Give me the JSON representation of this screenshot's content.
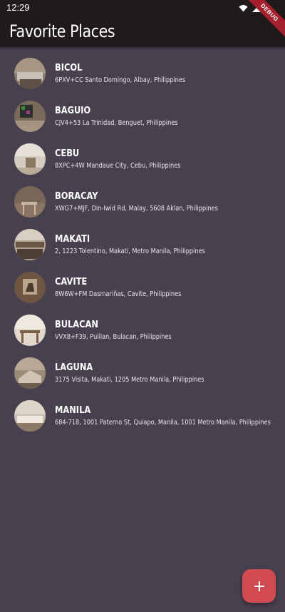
{
  "status_bar": {
    "time": "12:29",
    "icons": [
      "wifi-icon",
      "signal-icon",
      "battery-icon"
    ]
  },
  "app_bar": {
    "title": "Favorite Places"
  },
  "debug_banner": {
    "label": "DEBUG"
  },
  "places": [
    {
      "title": "BICOL",
      "address": "6PXV+CC Santo Domingo, Albay, Philippines"
    },
    {
      "title": "BAGUIO",
      "address": "CJV4+53 La Trinidad, Benguet, Philippines"
    },
    {
      "title": "CEBU",
      "address": "8XPC+4W Mandaue City, Cebu, Philippines"
    },
    {
      "title": "BORACAY",
      "address": "XWG7+MJF, Din-Iwid Rd, Malay, 5608 Aklan, Philippines"
    },
    {
      "title": "MAKATI",
      "address": "2, 1223 Tolentino, Makati, Metro Manila, Philippines"
    },
    {
      "title": "CAVITE",
      "address": "8W6W+FM Dasmariñas, Cavite, Philippines"
    },
    {
      "title": "BULACAN",
      "address": "VVX8+F39, Pulilan, Bulacan, Philippines"
    },
    {
      "title": "LAGUNA",
      "address": "3175 Visita, Makati, 1205 Metro Manila, Philippines"
    },
    {
      "title": "MANILA",
      "address": "684-718, 1001 Paterno St, Quiapo, Manila, 1001 Metro Manila, Philippines"
    }
  ],
  "fab": {
    "icon": "plus-icon"
  },
  "colors": {
    "background": "#47404f",
    "app_bar": "#1f1b1b",
    "fab": "#d24b51",
    "debug_banner": "#a3202c"
  }
}
